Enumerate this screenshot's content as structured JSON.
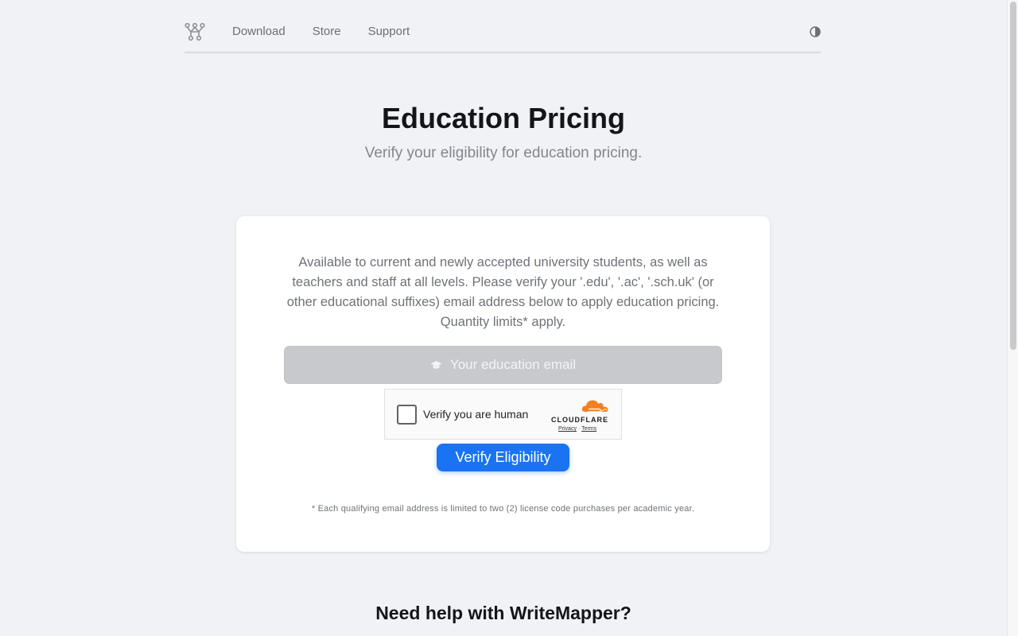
{
  "nav": {
    "logo_icon": "writemapper-logo-icon",
    "links": [
      {
        "label": "Download"
      },
      {
        "label": "Store"
      },
      {
        "label": "Support"
      }
    ],
    "theme_toggle_icon": "contrast-icon"
  },
  "hero": {
    "title": "Education Pricing",
    "subtitle": "Verify your eligibility for education pricing."
  },
  "card": {
    "description": "Available to current and newly accepted university students, as well as teachers and staff at all levels. Please verify your '.edu', '.ac', '.sch.uk' (or other educational suffixes) email address below to apply education pricing. Quantity limits* apply.",
    "email_placeholder": "Your education email",
    "email_value": "",
    "email_icon": "graduation-cap-icon",
    "captcha": {
      "label": "Verify you are human",
      "brand": "CLOUDFLARE",
      "privacy": "Privacy",
      "separator": "·",
      "terms": "Terms"
    },
    "verify_button": "Verify Eligibility",
    "footnote": "* Each qualifying email address is limited to two (2) license code purchases per academic year."
  },
  "help": {
    "title": "Need help with WriteMapper?"
  },
  "colors": {
    "background": "#f0f2f6",
    "accent": "#1a73f2",
    "cloudflare_orange": "#f38020"
  }
}
